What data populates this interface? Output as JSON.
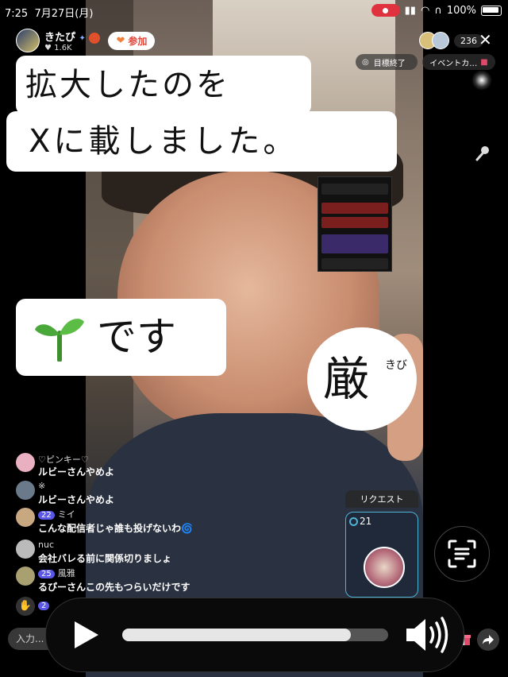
{
  "status_bar": {
    "time": "7:25",
    "date": "7月27日(月)",
    "battery": "100%"
  },
  "streamer": {
    "name": "きたぴ",
    "likes": "1.6K",
    "join_label": "参加"
  },
  "viewers": {
    "count": "236"
  },
  "pills": {
    "goal": "目標終了",
    "event": "イベントカ…"
  },
  "overlay": {
    "line1": "拡大したのを",
    "line2": "Xに載しました。",
    "line3": "です",
    "seal_char": "厳",
    "seal_small": "きび"
  },
  "chat": [
    {
      "user": "♡ピンキー♡",
      "text": "ルビーさんやめよ",
      "level": ""
    },
    {
      "user": "※",
      "text": "ルビーさんやめよ",
      "level": ""
    },
    {
      "user": "ミイ",
      "text": "こんな配信者じゃ誰も投げないわ🌀",
      "level": "22"
    },
    {
      "user": "nuc",
      "text": "会社バレる前に関係切りましょ",
      "level": ""
    },
    {
      "user": "風雅",
      "text": "るぴーさんこの先もつらいだけです",
      "level": "25"
    },
    {
      "user": "",
      "text": "",
      "level": "2"
    }
  ],
  "request": {
    "label": "リクエスト",
    "count": "21"
  },
  "input": {
    "placeholder": "入力..."
  },
  "player": {
    "progress": 0.86
  },
  "icons": {
    "mic": "microphone-icon",
    "scan": "scan-icon",
    "play": "play-icon",
    "volume": "volume-icon",
    "share": "share-icon",
    "gift": "gift-icon"
  }
}
